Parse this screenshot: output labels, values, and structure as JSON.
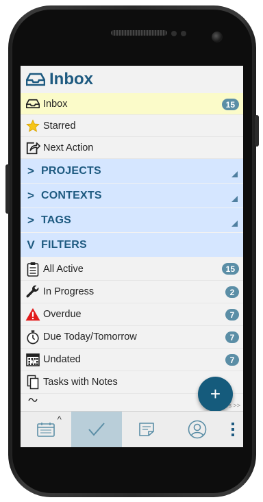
{
  "header": {
    "title": "Inbox",
    "icon": "inbox-tray-icon"
  },
  "menu": [
    {
      "label": "Inbox",
      "icon": "inbox-tray-icon",
      "badge": "15",
      "selected": true
    },
    {
      "label": "Starred",
      "icon": "star-icon"
    },
    {
      "label": "Next Action",
      "icon": "share-arrow-icon"
    }
  ],
  "sections": [
    {
      "label": "PROJECTS",
      "chevron": ">"
    },
    {
      "label": "CONTEXTS",
      "chevron": ">"
    },
    {
      "label": "TAGS",
      "chevron": ">"
    },
    {
      "label": "FILTERS",
      "chevron": "V"
    }
  ],
  "filters": [
    {
      "label": "All Active",
      "icon": "clipboard-icon",
      "badge": "15"
    },
    {
      "label": "In Progress",
      "icon": "wrench-icon",
      "badge": "2"
    },
    {
      "label": "Overdue",
      "icon": "warning-icon",
      "badge": "7"
    },
    {
      "label": "Due Today/Tomorrow",
      "icon": "stopwatch-icon",
      "badge": "7"
    },
    {
      "label": "Undated",
      "icon": "calendar-icon",
      "badge": "7"
    },
    {
      "label": "Tasks with Notes",
      "icon": "notes-icon"
    }
  ],
  "partial_row_icon": "link-icon",
  "more_link": "ers >>",
  "fab_label": "+",
  "bottom_nav": [
    {
      "name": "calendar-tab",
      "icon": "calendar-icon",
      "caret": "^"
    },
    {
      "name": "tasks-tab",
      "icon": "checkmark-icon",
      "active": true
    },
    {
      "name": "notes-tab",
      "icon": "note-icon"
    },
    {
      "name": "profile-tab",
      "icon": "person-icon"
    }
  ],
  "overflow_menu": "⋮",
  "colors": {
    "accent": "#1e5a80",
    "section_bg": "#d5e6ff",
    "selected_bg": "#fbfbc9",
    "badge": "#5b8ea6",
    "fab": "#155b7c"
  }
}
